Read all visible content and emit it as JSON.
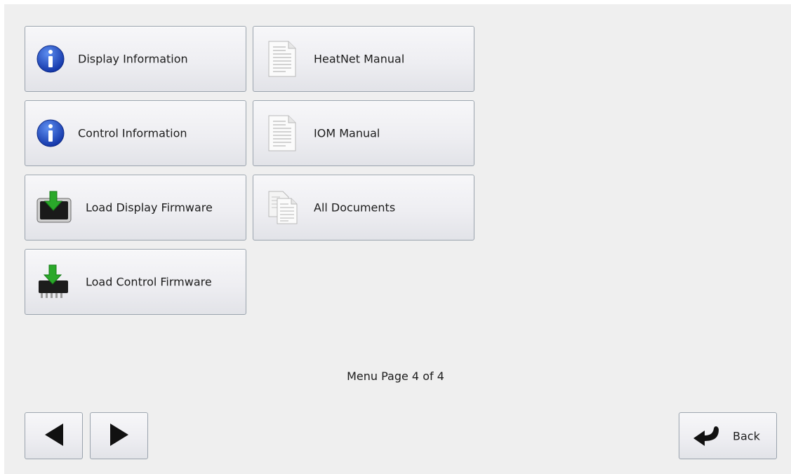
{
  "menu": {
    "items": [
      {
        "label": "Display Information",
        "icon": "info-icon"
      },
      {
        "label": "HeatNet Manual",
        "icon": "document-icon"
      },
      {
        "label": "Control Information",
        "icon": "info-icon"
      },
      {
        "label": "IOM Manual",
        "icon": "document-icon"
      },
      {
        "label": "Load Display Firmware",
        "icon": "display-download-icon"
      },
      {
        "label": "All Documents",
        "icon": "documents-icon"
      },
      {
        "label": "Load Control Firmware",
        "icon": "chip-download-icon"
      }
    ]
  },
  "footer": {
    "page_indicator": "Menu Page 4 of 4",
    "prev_icon": "arrow-left-icon",
    "next_icon": "arrow-right-icon",
    "back_label": "Back",
    "back_icon": "return-arrow-icon"
  },
  "colors": {
    "background": "#efefef",
    "button_border": "#9aa3ad",
    "info_blue": "#1f4fc8",
    "download_green": "#2aa82a"
  }
}
